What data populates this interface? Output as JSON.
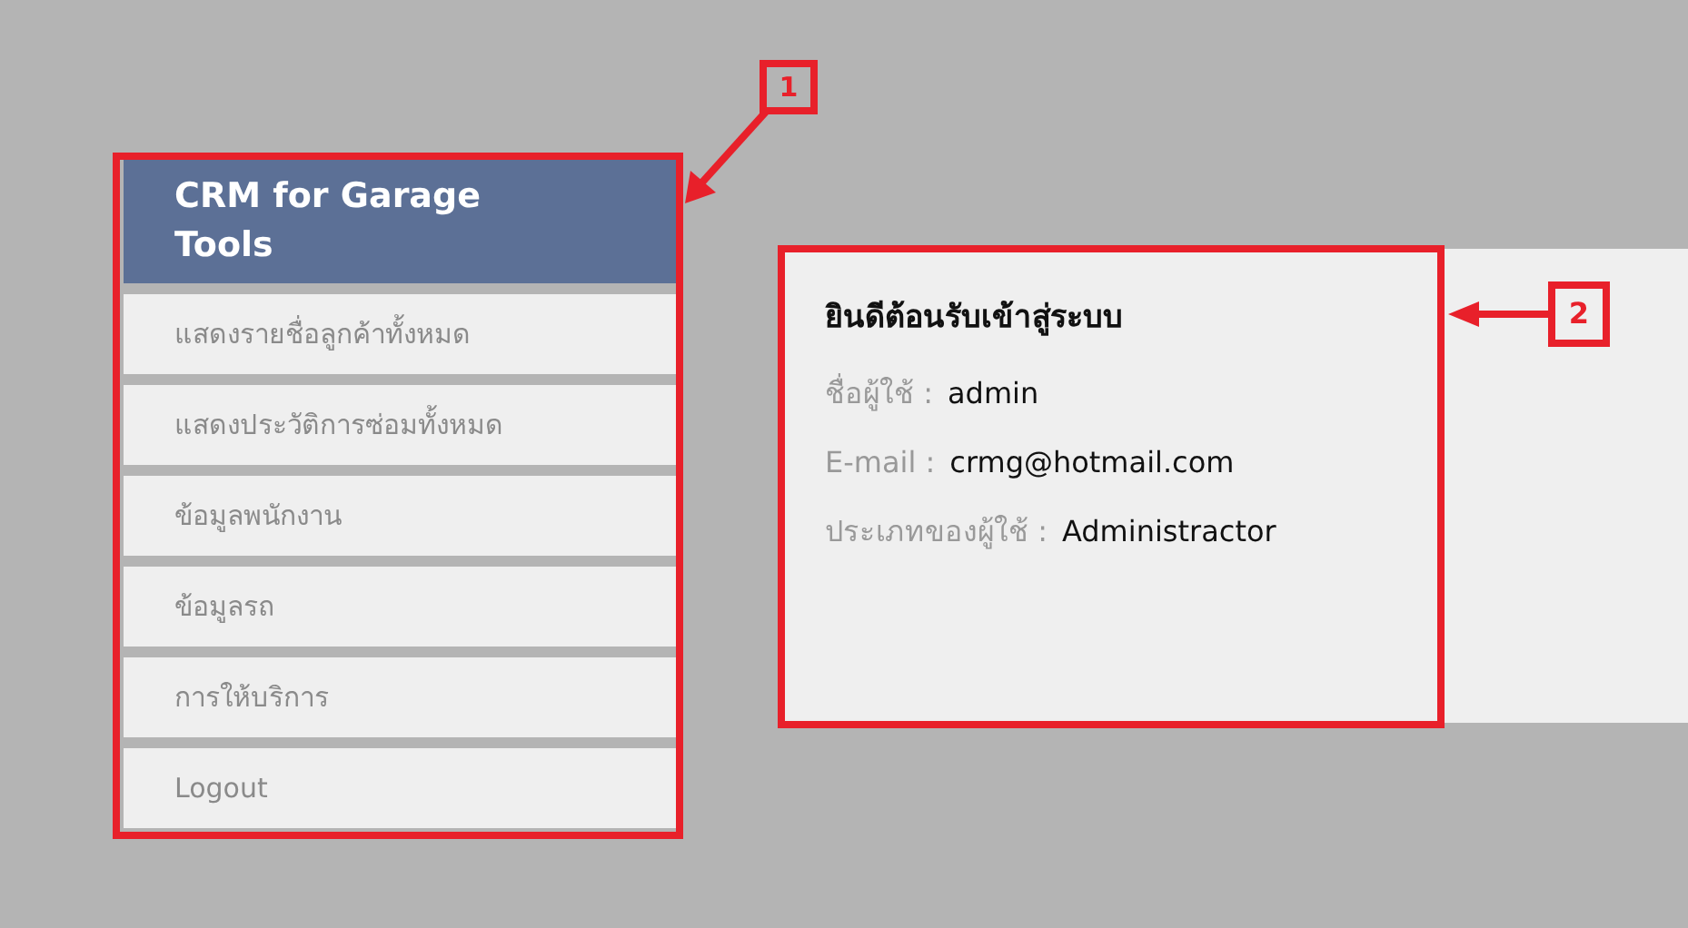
{
  "sidebar": {
    "title": "CRM for Garage Tools",
    "items": [
      {
        "label": "แสดงรายชื่อลูกค้าทั้งหมด"
      },
      {
        "label": "แสดงประวัติการซ่อมทั้งหมด"
      },
      {
        "label": "ข้อมูลพนักงาน"
      },
      {
        "label": "ข้อมูลรถ"
      },
      {
        "label": "การให้บริการ"
      },
      {
        "label": "Logout"
      }
    ]
  },
  "welcome": {
    "title": "ยินดีต้อนรับเข้าสู่ระบบ",
    "fields": [
      {
        "label": "ชื่อผู้ใช้ :",
        "value": "admin"
      },
      {
        "label": "E-mail :",
        "value": "crmg@hotmail.com"
      },
      {
        "label": "ประเภทของผู้ใช้ :",
        "value": "Administractor"
      }
    ]
  },
  "callouts": [
    "1",
    "2"
  ]
}
